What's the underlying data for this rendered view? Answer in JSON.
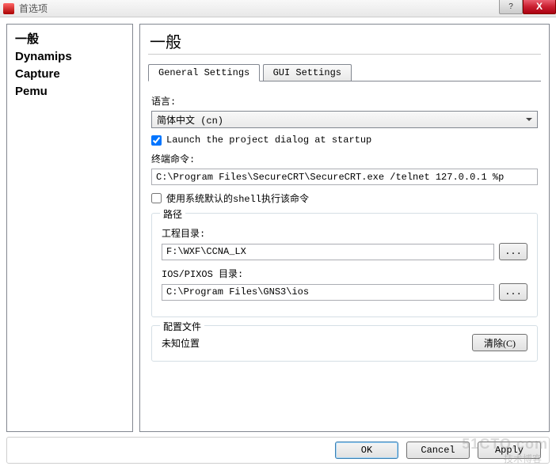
{
  "window": {
    "title": "首选项"
  },
  "sidebar": {
    "items": [
      {
        "label": "一般"
      },
      {
        "label": "Dynamips"
      },
      {
        "label": "Capture"
      },
      {
        "label": "Pemu"
      }
    ]
  },
  "main": {
    "title": "一般",
    "tabs": [
      {
        "label": "General Settings"
      },
      {
        "label": "GUI Settings"
      }
    ],
    "language_label": "语言:",
    "language_value": "简体中文 (cn)",
    "launch_startup_checked": true,
    "launch_startup_label": "Launch the project dialog at startup",
    "terminal_label": "终端命令:",
    "terminal_value": "C:\\Program Files\\SecureCRT\\SecureCRT.exe /telnet 127.0.0.1 %p",
    "use_default_shell_checked": false,
    "use_default_shell_label": "使用系统默认的shell执行该命令",
    "paths_group": {
      "title": "路径",
      "proj_label": "工程目录:",
      "proj_value": "F:\\WXF\\CCNA_LX",
      "ios_label": "IOS/PIXOS 目录:",
      "ios_value": "C:\\Program Files\\GNS3\\ios",
      "browse_label": "..."
    },
    "config_group": {
      "title": "配置文件",
      "unknown_label": "未知位置",
      "clear_label": "清除(C)"
    }
  },
  "footer": {
    "ok": "OK",
    "cancel": "Cancel",
    "apply": "Apply"
  },
  "watermark1": "51CTO.com",
  "watermark2": "技术博客"
}
